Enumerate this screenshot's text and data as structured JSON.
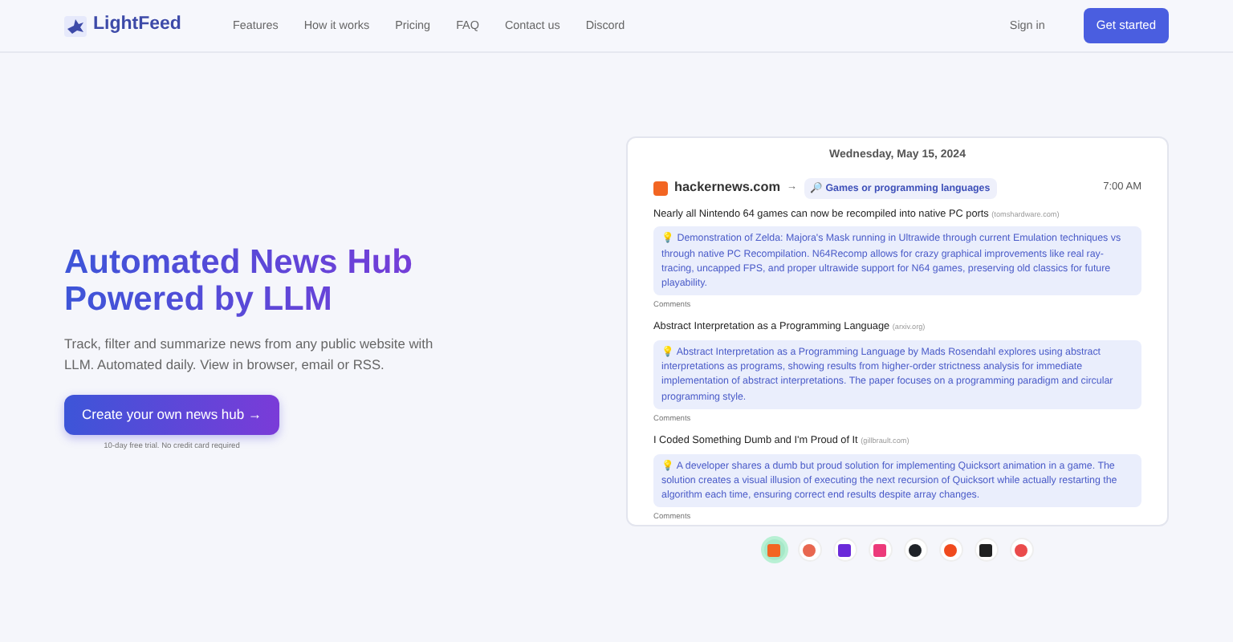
{
  "brand": "LightFeed",
  "nav": [
    "Features",
    "How it works",
    "Pricing",
    "FAQ",
    "Contact us",
    "Discord"
  ],
  "sign_in": "Sign in",
  "get_started": "Get started",
  "hero": {
    "title": "Automated News Hub Powered by LLM",
    "subtitle": "Track, filter and summarize news from any public website with LLM. Automated daily. View in browser, email or RSS.",
    "cta": "Create your own news hub →",
    "note": "10-day free trial. No credit card required"
  },
  "feed": {
    "date": "Wednesday, May 15, 2024",
    "source": "hackernews.com",
    "arrow": "→",
    "filter": "🔎 Games or programming languages",
    "time": "7:00 AM",
    "items": [
      {
        "title": "Nearly all Nintendo 64 games can now be recompiled into native PC ports",
        "domain": "(tomshardware.com)",
        "summary": "💡 Demonstration of Zelda: Majora's Mask running in Ultrawide through current Emulation techniques vs through native PC Recompilation. N64Recomp allows for crazy graphical improvements like real ray-tracing, uncapped FPS, and proper ultrawide support for N64 games, preserving old classics for future playability.",
        "comments": "Comments"
      },
      {
        "title": "Abstract Interpretation as a Programming Language",
        "domain": "(arxiv.org)",
        "summary": "💡 Abstract Interpretation as a Programming Language by Mads Rosendahl explores using abstract interpretations as programs, showing results from higher-order strictness analysis for immediate implementation of abstract interpretations. The paper focuses on a programming paradigm and circular programming style.",
        "comments": "Comments"
      },
      {
        "title": "I Coded Something Dumb and I'm Proud of It",
        "domain": "(gillbrault.com)",
        "summary": "💡 A developer shares a dumb but proud solution for implementing Quicksort animation in a game. The solution creates a visual illusion of executing the next recursion of Quicksort while actually restarting the algorithm each time, ensuring correct end results despite array changes.",
        "comments": "Comments"
      }
    ]
  },
  "sources": [
    {
      "kind": "square",
      "color": "#f26522",
      "selected": true
    },
    {
      "kind": "circle",
      "color": "#e8674f",
      "selected": false
    },
    {
      "kind": "square",
      "color": "#6b2bd9",
      "selected": false
    },
    {
      "kind": "square",
      "color": "#ec3a7a",
      "selected": false
    },
    {
      "kind": "circle",
      "color": "#1f2328",
      "selected": false
    },
    {
      "kind": "circle",
      "color": "#f04a1d",
      "selected": false
    },
    {
      "kind": "square",
      "color": "#222222",
      "selected": false
    },
    {
      "kind": "circle",
      "color": "#ea4b4b",
      "selected": false
    }
  ]
}
